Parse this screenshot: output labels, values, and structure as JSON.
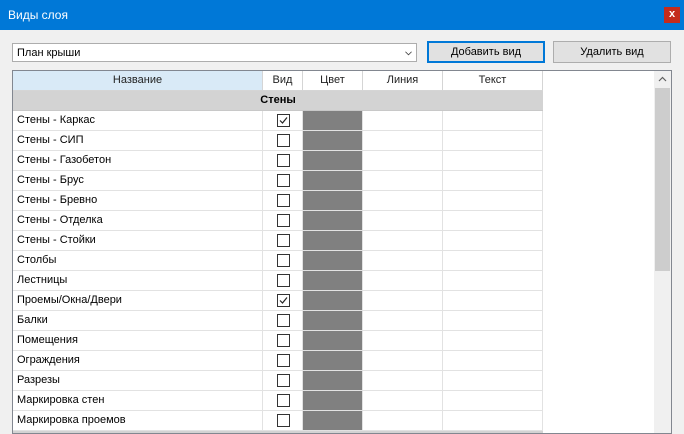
{
  "window": {
    "title": "Виды слоя",
    "close_glyph": "x"
  },
  "toolbar": {
    "view_select": {
      "value": "План крыши"
    },
    "add_label": "Добавить вид",
    "delete_label": "Удалить вид"
  },
  "grid": {
    "columns": [
      "Название",
      "Вид",
      "Цвет",
      "Линия",
      "Текст"
    ],
    "group": "Стены",
    "color_swatch": "#808080",
    "rows": [
      {
        "name": "Стены - Каркас",
        "checked": true
      },
      {
        "name": "Стены - СИП",
        "checked": false
      },
      {
        "name": "Стены - Газобетон",
        "checked": false
      },
      {
        "name": "Стены - Брус",
        "checked": false
      },
      {
        "name": "Стены - Бревно",
        "checked": false
      },
      {
        "name": "Стены - Отделка",
        "checked": false
      },
      {
        "name": "Стены - Стойки",
        "checked": false
      },
      {
        "name": "Столбы",
        "checked": false
      },
      {
        "name": "Лестницы",
        "checked": false
      },
      {
        "name": "Проемы/Окна/Двери",
        "checked": true
      },
      {
        "name": "Балки",
        "checked": false
      },
      {
        "name": "Помещения",
        "checked": false
      },
      {
        "name": "Ограждения",
        "checked": false
      },
      {
        "name": "Разрезы",
        "checked": false
      },
      {
        "name": "Маркировка стен",
        "checked": false
      },
      {
        "name": "Маркировка проемов",
        "checked": false
      }
    ]
  }
}
